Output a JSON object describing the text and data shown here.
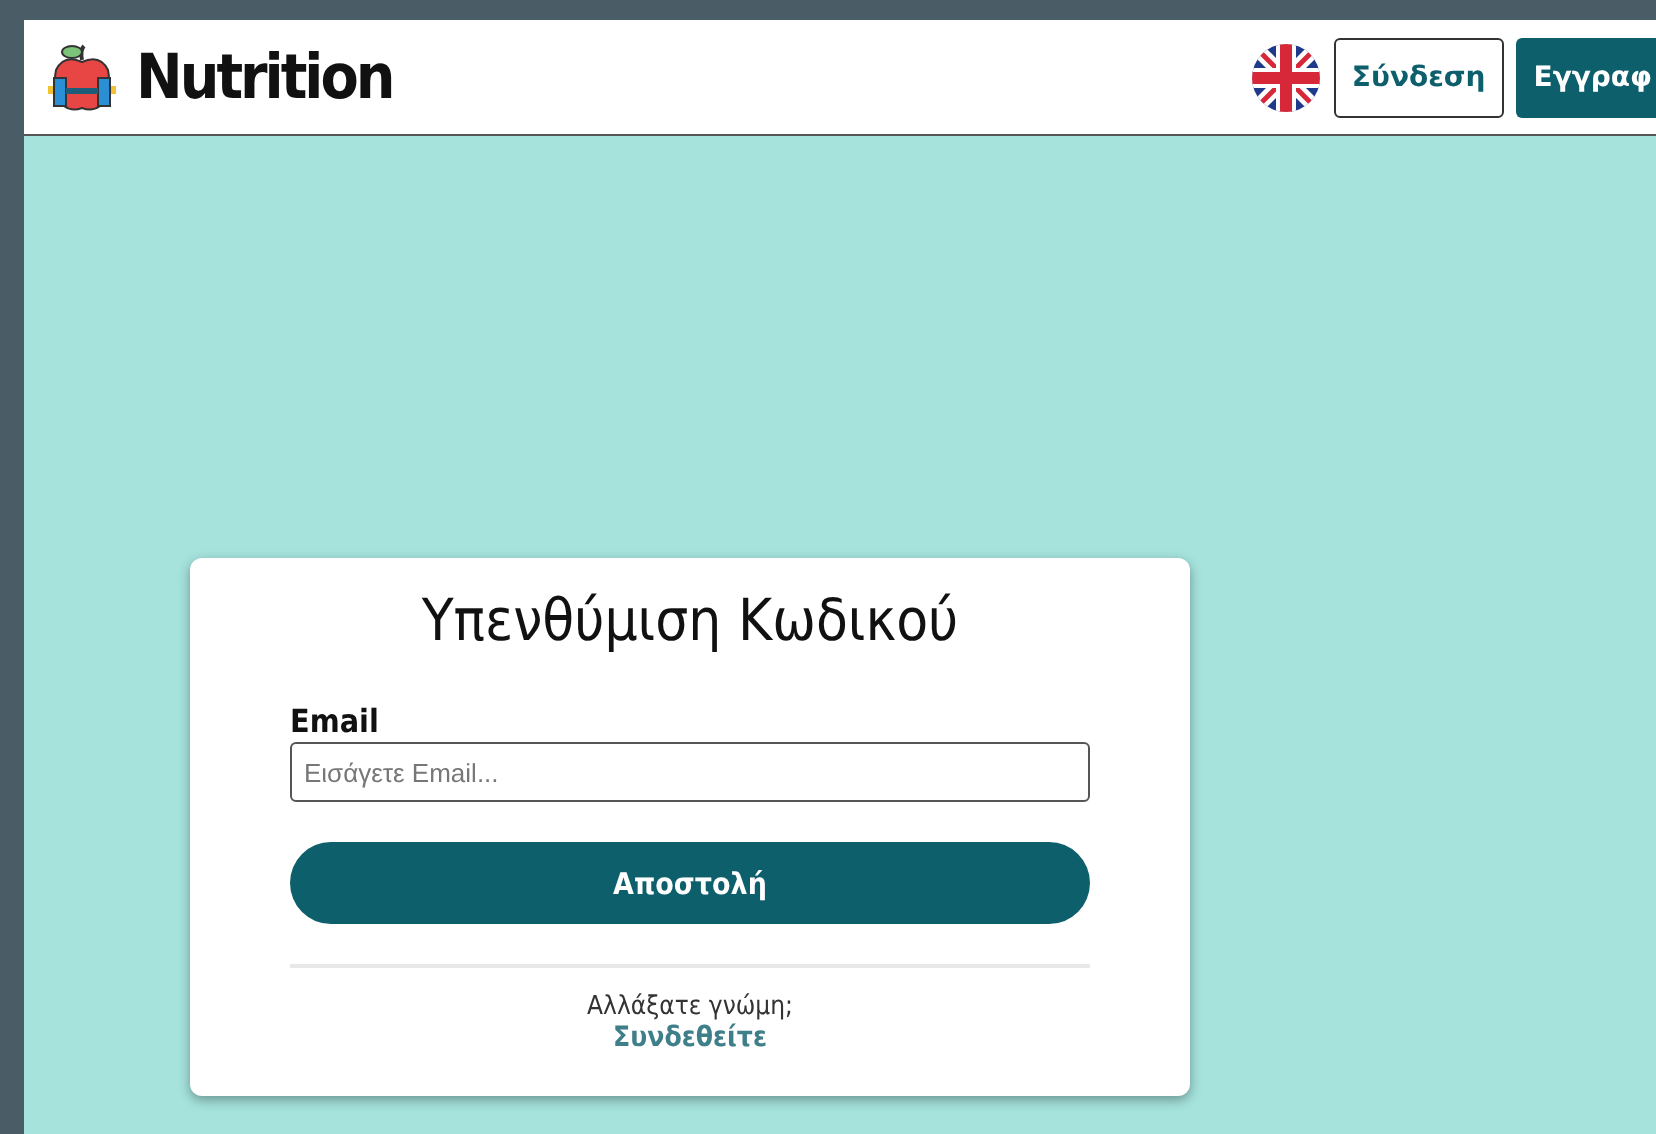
{
  "header": {
    "logo_text": "Nutrition",
    "buttons": [
      {
        "label": "Σύνδεση",
        "kind": "outline"
      },
      {
        "label": "Εγγραφ",
        "kind": "filled"
      }
    ]
  },
  "card": {
    "title": "Υπενθύμιση Κωδικού",
    "field": {
      "label": "Email",
      "placeholder": "Εισάγετε Email..."
    },
    "submit": "Αποστολή",
    "prompt": "Αλλάξατε γνώμη;",
    "link": "Συνδεθείτε"
  }
}
